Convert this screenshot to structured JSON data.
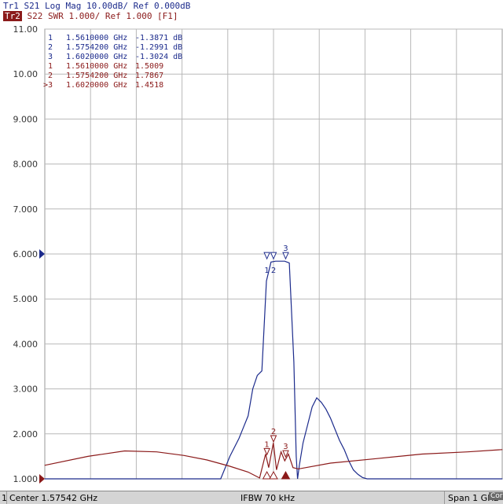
{
  "header": {
    "trace1": {
      "tag": "Tr1",
      "text": " S21 Log Mag 10.00dB/ Ref 0.000dB"
    },
    "trace2": {
      "tag": "Tr2",
      "text": " S22 SWR 1.000/ Ref 1.000 [F1]"
    }
  },
  "footer": {
    "channel": "1",
    "center": "Center 1.57542 GHz",
    "ifbw": "IFBW 70 kHz",
    "span": "Span 1 GHz",
    "correction": "Cor"
  },
  "colors": {
    "trace1": "#1c2b8c",
    "trace2": "#8b1a1a",
    "grid": "#b8b8b8",
    "background": "#ffffff"
  },
  "chart_data": {
    "type": "line",
    "ylim": [
      1.0,
      11.0
    ],
    "xlim": [
      1.07542,
      2.07542
    ],
    "x_unit": "GHz",
    "grid": true,
    "y_ticks": [
      "1.000",
      "2.000",
      "3.000",
      "4.000",
      "5.000",
      "6.000",
      "7.000",
      "8.000",
      "9.000",
      "10.00",
      "11.00"
    ],
    "reference_marker_y": 6.0,
    "markers": [
      {
        "num": "1",
        "freq": "1.5610000 GHz",
        "value": "-1.3871 dB",
        "trace": 1
      },
      {
        "num": "2",
        "freq": "1.5754200 GHz",
        "value": "-1.2991 dB",
        "trace": 1
      },
      {
        "num": "3",
        "freq": "1.6020000 GHz",
        "value": "-1.3024 dB",
        "trace": 1
      },
      {
        "num": "1",
        "freq": "1.5610000 GHz",
        "value": "1.5009",
        "trace": 2
      },
      {
        "num": "2",
        "freq": "1.5754200 GHz",
        "value": "1.7867",
        "trace": 2
      },
      {
        "num": ">3",
        "freq": "1.6020000 GHz",
        "value": "1.4518",
        "trace": 2
      }
    ],
    "series": [
      {
        "trace": "Tr1 S21",
        "x": [
          1.075,
          1.46,
          1.48,
          1.5,
          1.51,
          1.52,
          1.53,
          1.54,
          1.55,
          1.56,
          1.57,
          1.58,
          1.59,
          1.6,
          1.61,
          1.62,
          1.625,
          1.628,
          1.632,
          1.64,
          1.65,
          1.66,
          1.67,
          1.68,
          1.69,
          1.7,
          1.71,
          1.72,
          1.73,
          1.74,
          1.75,
          1.76,
          1.77,
          1.78,
          1.79,
          2.076
        ],
        "y": [
          1.0,
          1.0,
          1.5,
          1.9,
          2.15,
          2.4,
          3.0,
          3.3,
          3.4,
          5.4,
          5.82,
          5.84,
          5.84,
          5.84,
          5.8,
          3.6,
          1.5,
          1.0,
          1.3,
          1.8,
          2.2,
          2.6,
          2.8,
          2.7,
          2.55,
          2.35,
          2.1,
          1.85,
          1.65,
          1.4,
          1.2,
          1.1,
          1.03,
          1.0,
          1.0,
          1.0
        ]
      },
      {
        "trace": "Tr2 S22",
        "x": [
          1.075,
          1.17,
          1.25,
          1.32,
          1.38,
          1.43,
          1.48,
          1.52,
          1.545,
          1.558,
          1.565,
          1.575,
          1.582,
          1.592,
          1.6,
          1.608,
          1.618,
          1.63,
          1.7,
          1.8,
          1.9,
          2.0,
          2.076
        ],
        "y": [
          1.3,
          1.5,
          1.62,
          1.6,
          1.52,
          1.42,
          1.28,
          1.15,
          1.02,
          1.55,
          1.25,
          1.8,
          1.2,
          1.6,
          1.4,
          1.55,
          1.25,
          1.22,
          1.35,
          1.45,
          1.55,
          1.6,
          1.65
        ]
      }
    ]
  }
}
